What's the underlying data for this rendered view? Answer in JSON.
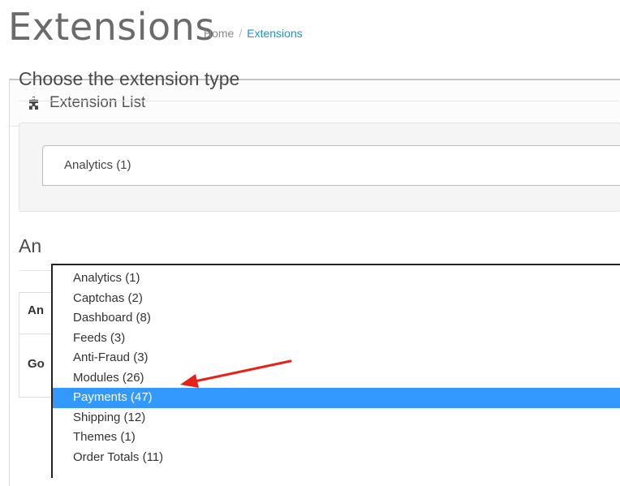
{
  "header": {
    "title": "Extensions",
    "breadcrumb": {
      "home": "Home",
      "separator": "/",
      "current": "Extensions"
    }
  },
  "panel": {
    "title": "Extension List",
    "icon": "puzzle-icon",
    "section_title": "Choose the extension type"
  },
  "select": {
    "selected_value": "Analytics (1)",
    "options": [
      {
        "label": "Analytics (1)"
      },
      {
        "label": "Captchas (2)"
      },
      {
        "label": "Dashboard (8)"
      },
      {
        "label": "Feeds (3)"
      },
      {
        "label": "Anti-Fraud (3)"
      },
      {
        "label": "Modules (26)"
      },
      {
        "label": "Payments (47)"
      },
      {
        "label": "Shipping (12)"
      },
      {
        "label": "Themes (1)"
      },
      {
        "label": "Order Totals (11)"
      }
    ],
    "highlighted_option": "Payments (47)"
  },
  "background": {
    "heading": "An",
    "row1_cell": "An",
    "row2_cell": "Go"
  },
  "colors": {
    "accent": "#1e91cf",
    "highlight": "#3399ff",
    "annotation_arrow": "#e8221b"
  }
}
